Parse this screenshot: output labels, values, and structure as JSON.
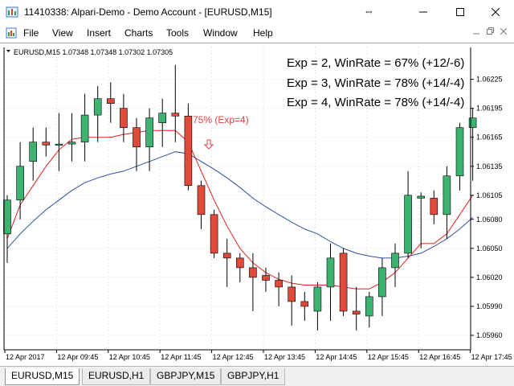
{
  "window": {
    "title": "11410338: Alpari-Demo - Demo Account - [EURUSD,M15]",
    "app_icon": "terminal-icon",
    "resize_icon": "resize-arrows-icon",
    "minimize_icon": "minimize-icon",
    "maximize_icon": "maximize-icon",
    "close_icon": "close-icon"
  },
  "menu": {
    "doc_icon": "chart-document-icon",
    "items": [
      "File",
      "View",
      "Insert",
      "Charts",
      "Tools",
      "Window",
      "Help"
    ],
    "mdi_controls": [
      "minimize-icon",
      "restore-icon",
      "close-icon"
    ]
  },
  "chart": {
    "header": "EURUSD,M15  1.07348 1.07348 1.07302 1.07305",
    "stats": [
      "Exp = 2, WinRate = 67% (+12/-6)",
      "Exp = 3, WinRate = 78% (+14/-4)",
      "Exp = 4, WinRate = 78% (+14/-4)"
    ],
    "signal_label": "75% (Exp=4)",
    "signal_arrow_icon": "down-arrow-icon",
    "colors": {
      "bull": "#3cb371",
      "bear": "#e04a3a",
      "ma_fast": "#e02020",
      "ma_slow": "#3050a0",
      "annotation": "#e04040"
    }
  },
  "chart_data": {
    "type": "candlestick",
    "symbol": "EURUSD,M15",
    "price_axis": [
      "1.06225",
      "1.06195",
      "1.06165",
      "1.06135",
      "1.06105",
      "1.06080",
      "1.06050",
      "1.06020",
      "1.05990",
      "1.05960"
    ],
    "time_axis": [
      "12 Apr 2017",
      "12 Apr 09:45",
      "12 Apr 10:45",
      "12 Apr 11:45",
      "12 Apr 12:45",
      "12 Apr 13:45",
      "12 Apr 14:45",
      "12 Apr 15:45",
      "12 Apr 16:45",
      "12 Apr 17:45"
    ],
    "ylim": [
      1.05945,
      1.06258
    ],
    "candles": [
      {
        "o": 1.06065,
        "h": 1.06105,
        "l": 1.06035,
        "c": 1.061
      },
      {
        "o": 1.061,
        "h": 1.0616,
        "l": 1.0608,
        "c": 1.06135
      },
      {
        "o": 1.0614,
        "h": 1.06175,
        "l": 1.0612,
        "c": 1.0616
      },
      {
        "o": 1.0616,
        "h": 1.06175,
        "l": 1.06145,
        "c": 1.06157
      },
      {
        "o": 1.06157,
        "h": 1.0619,
        "l": 1.0613,
        "c": 1.06158
      },
      {
        "o": 1.06158,
        "h": 1.0619,
        "l": 1.0614,
        "c": 1.0616
      },
      {
        "o": 1.0616,
        "h": 1.0621,
        "l": 1.0614,
        "c": 1.06188
      },
      {
        "o": 1.06188,
        "h": 1.06218,
        "l": 1.0616,
        "c": 1.06205
      },
      {
        "o": 1.06205,
        "h": 1.06222,
        "l": 1.0618,
        "c": 1.062
      },
      {
        "o": 1.06195,
        "h": 1.0621,
        "l": 1.0616,
        "c": 1.06175
      },
      {
        "o": 1.06175,
        "h": 1.06185,
        "l": 1.0613,
        "c": 1.06155
      },
      {
        "o": 1.06155,
        "h": 1.06195,
        "l": 1.0613,
        "c": 1.06185
      },
      {
        "o": 1.0618,
        "h": 1.06205,
        "l": 1.06155,
        "c": 1.0619
      },
      {
        "o": 1.0619,
        "h": 1.0624,
        "l": 1.0616,
        "c": 1.06187
      },
      {
        "o": 1.06187,
        "h": 1.062,
        "l": 1.0611,
        "c": 1.06115
      },
      {
        "o": 1.06115,
        "h": 1.0612,
        "l": 1.0607,
        "c": 1.06085
      },
      {
        "o": 1.06085,
        "h": 1.0609,
        "l": 1.0604,
        "c": 1.06045
      },
      {
        "o": 1.06045,
        "h": 1.0606,
        "l": 1.0601,
        "c": 1.0604
      },
      {
        "o": 1.0604,
        "h": 1.06045,
        "l": 1.06015,
        "c": 1.0603
      },
      {
        "o": 1.0603,
        "h": 1.06045,
        "l": 1.05985,
        "c": 1.0602
      },
      {
        "o": 1.06022,
        "h": 1.0603,
        "l": 1.06005,
        "c": 1.06017
      },
      {
        "o": 1.06017,
        "h": 1.06025,
        "l": 1.0599,
        "c": 1.0601
      },
      {
        "o": 1.0601,
        "h": 1.06022,
        "l": 1.0597,
        "c": 1.05995
      },
      {
        "o": 1.05995,
        "h": 1.06005,
        "l": 1.05975,
        "c": 1.0599
      },
      {
        "o": 1.05985,
        "h": 1.06015,
        "l": 1.05965,
        "c": 1.0601
      },
      {
        "o": 1.0601,
        "h": 1.06055,
        "l": 1.05975,
        "c": 1.0604
      },
      {
        "o": 1.06045,
        "h": 1.0605,
        "l": 1.0598,
        "c": 1.05985
      },
      {
        "o": 1.05985,
        "h": 1.0601,
        "l": 1.05965,
        "c": 1.05982
      },
      {
        "o": 1.0598,
        "h": 1.06005,
        "l": 1.05968,
        "c": 1.06
      },
      {
        "o": 1.06,
        "h": 1.0604,
        "l": 1.0598,
        "c": 1.0603
      },
      {
        "o": 1.0603,
        "h": 1.06055,
        "l": 1.0601,
        "c": 1.06045
      },
      {
        "o": 1.06045,
        "h": 1.0613,
        "l": 1.0604,
        "c": 1.06105
      },
      {
        "o": 1.06102,
        "h": 1.06108,
        "l": 1.0605,
        "c": 1.06104
      },
      {
        "o": 1.06102,
        "h": 1.0611,
        "l": 1.06075,
        "c": 1.06085
      },
      {
        "o": 1.06085,
        "h": 1.06135,
        "l": 1.0606,
        "c": 1.06125
      },
      {
        "o": 1.06125,
        "h": 1.0618,
        "l": 1.0611,
        "c": 1.06175
      },
      {
        "o": 1.06175,
        "h": 1.06195,
        "l": 1.0612,
        "c": 1.06185
      }
    ],
    "ma_fast": [
      1.0606,
      1.06095,
      1.06115,
      1.06135,
      1.06152,
      1.06163,
      1.06165,
      1.06165,
      1.06165,
      1.06168,
      1.0617,
      1.06172,
      1.06172,
      1.06172,
      1.0616,
      1.0613,
      1.061,
      1.06073,
      1.0605,
      1.06035,
      1.06025,
      1.06018,
      1.06014,
      1.06012,
      1.06012,
      1.06012,
      1.0601,
      1.06008,
      1.06008,
      1.06015,
      1.06025,
      1.0604,
      1.06055,
      1.06055,
      1.06065,
      1.06085,
      1.06105
    ],
    "ma_slow": [
      1.0605,
      1.06065,
      1.06078,
      1.0609,
      1.061,
      1.0611,
      1.06118,
      1.06123,
      1.06127,
      1.0613,
      1.06135,
      1.0614,
      1.06145,
      1.0615,
      1.06148,
      1.0614,
      1.06132,
      1.06123,
      1.06113,
      1.06102,
      1.06093,
      1.06085,
      1.06077,
      1.0607,
      1.06065,
      1.06057,
      1.0605,
      1.06045,
      1.06042,
      1.0604,
      1.0604,
      1.06042,
      1.06045,
      1.06052,
      1.0606,
      1.0607,
      1.06082
    ]
  },
  "tabs": [
    {
      "label": "EURUSD,M15",
      "active": true
    },
    {
      "label": "EURUSD,H1",
      "active": false
    },
    {
      "label": "GBPJPY,M15",
      "active": false
    },
    {
      "label": "GBPJPY,H1",
      "active": false
    }
  ]
}
